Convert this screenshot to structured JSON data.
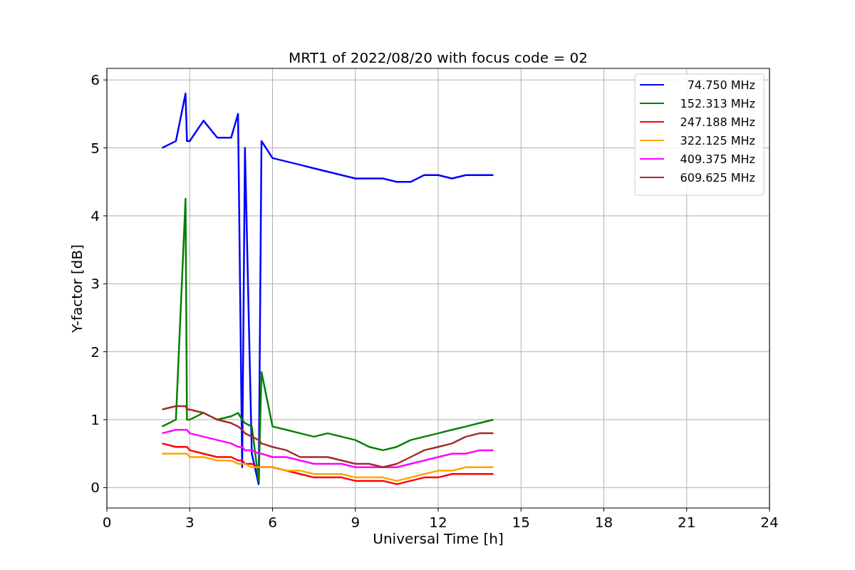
{
  "chart_data": {
    "type": "line",
    "title": "MRT1 of 2022/08/20 with focus code = 02",
    "xlabel": "Universal Time [h]",
    "ylabel": "Y-factor [dB]",
    "x": [
      2,
      2.5,
      2.85,
      2.9,
      3,
      3.5,
      4,
      4.5,
      4.75,
      4.9,
      5,
      5.25,
      5.5,
      5.6,
      6,
      6.5,
      7,
      7.5,
      8,
      8.5,
      9,
      9.5,
      10,
      10.5,
      11,
      11.5,
      12,
      12.5,
      13,
      13.5,
      14
    ],
    "series": [
      {
        "name": "74.750 MHz",
        "color": "#0000ff",
        "values": [
          5.0,
          5.1,
          5.8,
          5.1,
          5.1,
          5.4,
          5.15,
          5.15,
          5.5,
          0.3,
          5.0,
          0.5,
          0.05,
          5.1,
          4.85,
          4.8,
          4.75,
          4.7,
          4.65,
          4.6,
          4.55,
          4.55,
          4.55,
          4.5,
          4.5,
          4.6,
          4.6,
          4.55,
          4.6,
          4.6,
          4.6
        ]
      },
      {
        "name": "152.313 MHz",
        "color": "#008000",
        "values": [
          0.9,
          1.0,
          4.25,
          1.0,
          1.0,
          1.1,
          1.0,
          1.05,
          1.1,
          1.0,
          0.95,
          0.9,
          0.1,
          1.7,
          0.9,
          0.85,
          0.8,
          0.75,
          0.8,
          0.75,
          0.7,
          0.6,
          0.55,
          0.6,
          0.7,
          0.75,
          0.8,
          0.85,
          0.9,
          0.95,
          1.0
        ]
      },
      {
        "name": "247.188 MHz",
        "color": "#ff0000",
        "values": [
          0.65,
          0.6,
          0.6,
          0.6,
          0.55,
          0.5,
          0.45,
          0.45,
          0.4,
          0.4,
          0.35,
          0.35,
          0.3,
          0.3,
          0.3,
          0.25,
          0.2,
          0.15,
          0.15,
          0.15,
          0.1,
          0.1,
          0.1,
          0.05,
          0.1,
          0.15,
          0.15,
          0.2,
          0.2,
          0.2,
          0.2
        ]
      },
      {
        "name": "322.125 MHz",
        "color": "#ffa500",
        "values": [
          0.5,
          0.5,
          0.5,
          0.5,
          0.45,
          0.45,
          0.4,
          0.4,
          0.35,
          0.35,
          0.35,
          0.3,
          0.3,
          0.3,
          0.3,
          0.25,
          0.25,
          0.2,
          0.2,
          0.2,
          0.15,
          0.15,
          0.15,
          0.1,
          0.15,
          0.2,
          0.25,
          0.25,
          0.3,
          0.3,
          0.3
        ]
      },
      {
        "name": "409.375 MHz",
        "color": "#ff00ff",
        "values": [
          0.8,
          0.85,
          0.85,
          0.85,
          0.8,
          0.75,
          0.7,
          0.65,
          0.6,
          0.6,
          0.55,
          0.55,
          0.5,
          0.5,
          0.45,
          0.45,
          0.4,
          0.35,
          0.35,
          0.35,
          0.3,
          0.3,
          0.3,
          0.3,
          0.35,
          0.4,
          0.45,
          0.5,
          0.5,
          0.55,
          0.55
        ]
      },
      {
        "name": "609.625 MHz",
        "color": "#a52a2a",
        "values": [
          1.15,
          1.2,
          1.2,
          1.15,
          1.15,
          1.1,
          1.0,
          0.95,
          0.9,
          0.85,
          0.8,
          0.75,
          0.7,
          0.65,
          0.6,
          0.55,
          0.45,
          0.45,
          0.45,
          0.4,
          0.35,
          0.35,
          0.3,
          0.35,
          0.45,
          0.55,
          0.6,
          0.65,
          0.75,
          0.8,
          0.8
        ]
      }
    ],
    "grid": true,
    "legend": true,
    "xlim": [
      0,
      24
    ],
    "ylim": [
      -0.3,
      6.17
    ],
    "xticks": [
      0,
      3,
      6,
      9,
      12,
      15,
      18,
      21,
      24
    ],
    "yticks": [
      0,
      1,
      2,
      3,
      4,
      5,
      6
    ]
  }
}
